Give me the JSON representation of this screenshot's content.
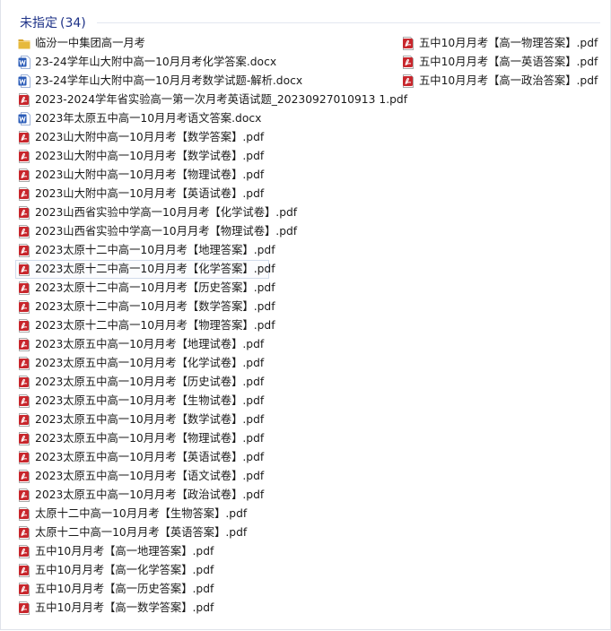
{
  "group": {
    "title": "未指定",
    "count": "(34)"
  },
  "columns": [
    [
      {
        "name": "临汾一中集团高一月考",
        "icon": "folder-icon"
      },
      {
        "name": "23-24学年山大附中高一10月月考化学答案.docx",
        "icon": "word-icon"
      },
      {
        "name": "23-24学年山大附中高一10月月考数学试题-解析.docx",
        "icon": "word-icon"
      },
      {
        "name": "2023-2024学年省实验高一第一次月考英语试题_20230927010913 1.pdf",
        "icon": "pdf-icon"
      },
      {
        "name": "2023年太原五中高一10月月考语文答案.docx",
        "icon": "word-icon"
      },
      {
        "name": "2023山大附中高一10月月考【数学答案】.pdf",
        "icon": "pdf-icon"
      },
      {
        "name": "2023山大附中高一10月月考【数学试卷】.pdf",
        "icon": "pdf-icon"
      },
      {
        "name": "2023山大附中高一10月月考【物理试卷】.pdf",
        "icon": "pdf-icon"
      },
      {
        "name": "2023山大附中高一10月月考【英语试卷】.pdf",
        "icon": "pdf-icon"
      },
      {
        "name": "2023山西省实验中学高一10月月考【化学试卷】.pdf",
        "icon": "pdf-icon"
      },
      {
        "name": "2023山西省实验中学高一10月月考【物理试卷】.pdf",
        "icon": "pdf-icon"
      },
      {
        "name": "2023太原十二中高一10月月考【地理答案】.pdf",
        "icon": "pdf-icon"
      },
      {
        "name": "2023太原十二中高一10月月考【化学答案】.pdf",
        "icon": "pdf-icon",
        "focused": true
      },
      {
        "name": "2023太原十二中高一10月月考【历史答案】.pdf",
        "icon": "pdf-icon"
      },
      {
        "name": "2023太原十二中高一10月月考【数学答案】.pdf",
        "icon": "pdf-icon"
      },
      {
        "name": "2023太原十二中高一10月月考【物理答案】.pdf",
        "icon": "pdf-icon"
      },
      {
        "name": "2023太原五中高一10月月考【地理试卷】.pdf",
        "icon": "pdf-icon"
      },
      {
        "name": "2023太原五中高一10月月考【化学试卷】.pdf",
        "icon": "pdf-icon"
      },
      {
        "name": "2023太原五中高一10月月考【历史试卷】.pdf",
        "icon": "pdf-icon"
      },
      {
        "name": "2023太原五中高一10月月考【生物试卷】.pdf",
        "icon": "pdf-icon"
      },
      {
        "name": "2023太原五中高一10月月考【数学试卷】.pdf",
        "icon": "pdf-icon"
      },
      {
        "name": "2023太原五中高一10月月考【物理试卷】.pdf",
        "icon": "pdf-icon"
      },
      {
        "name": "2023太原五中高一10月月考【英语试卷】.pdf",
        "icon": "pdf-icon"
      },
      {
        "name": "2023太原五中高一10月月考【语文试卷】.pdf",
        "icon": "pdf-icon"
      },
      {
        "name": "2023太原五中高一10月月考【政治试卷】.pdf",
        "icon": "pdf-icon"
      },
      {
        "name": "太原十二中高一10月月考【生物答案】.pdf",
        "icon": "pdf-icon"
      },
      {
        "name": "太原十二中高一10月月考【英语答案】.pdf",
        "icon": "pdf-icon"
      },
      {
        "name": "五中10月月考【高一地理答案】.pdf",
        "icon": "pdf-icon"
      },
      {
        "name": "五中10月月考【高一化学答案】.pdf",
        "icon": "pdf-icon"
      },
      {
        "name": "五中10月月考【高一历史答案】.pdf",
        "icon": "pdf-icon"
      },
      {
        "name": "五中10月月考【高一数学答案】.pdf",
        "icon": "pdf-icon"
      }
    ],
    [
      {
        "name": "五中10月月考【高一物理答案】.pdf",
        "icon": "pdf-icon"
      },
      {
        "name": "五中10月月考【高一英语答案】.pdf",
        "icon": "pdf-icon"
      },
      {
        "name": "五中10月月考【高一政治答案】.pdf",
        "icon": "pdf-icon"
      }
    ]
  ],
  "colors": {
    "header_text": "#1e3287",
    "pdf_red": "#c8262c",
    "word_blue": "#2b5cb8",
    "folder_yellow": "#e6b93c"
  }
}
